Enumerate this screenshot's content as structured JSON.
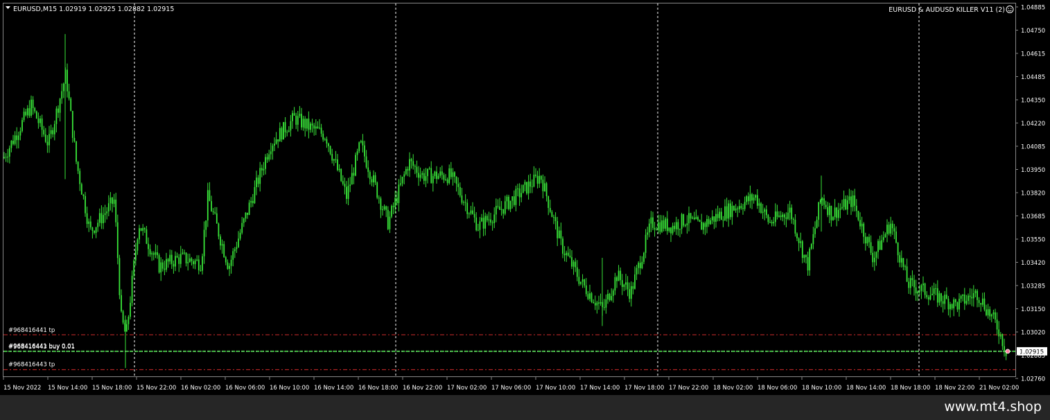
{
  "chart_header": {
    "symbol_info": "EURUSD,M15  1.02919 1.02925 1.02882 1.02915",
    "expert_name": "EURUSD & AUDUSD KILLER V11 (2)",
    "expert_icon": "smiley-face-icon"
  },
  "price_axis": {
    "labels": [
      "1.04885",
      "1.04750",
      "1.04615",
      "1.04485",
      "1.04350",
      "1.04220",
      "1.04085",
      "1.03950",
      "1.03820",
      "1.03685",
      "1.03550",
      "1.03420",
      "1.03285",
      "1.03150",
      "1.03020",
      "1.02885",
      "1.02760"
    ],
    "current_price": "1.02915"
  },
  "time_axis": {
    "labels": [
      "15 Nov 2022",
      "15 Nov 14:00",
      "15 Nov 18:00",
      "15 Nov 22:00",
      "16 Nov 02:00",
      "16 Nov 06:00",
      "16 Nov 10:00",
      "16 Nov 14:00",
      "16 Nov 18:00",
      "16 Nov 22:00",
      "17 Nov 02:00",
      "17 Nov 06:00",
      "17 Nov 10:00",
      "17 Nov 14:00",
      "17 Nov 18:00",
      "17 Nov 22:00",
      "18 Nov 02:00",
      "18 Nov 06:00",
      "18 Nov 10:00",
      "18 Nov 14:00",
      "18 Nov 18:00",
      "18 Nov 22:00",
      "21 Nov 02:00"
    ]
  },
  "order_lines": {
    "tp_top": "#968416441 tp",
    "entry": "#968416441 buy 0.01",
    "entry_overlap": "#968416443 buy 0.01",
    "tp_bottom": "#968416443 tp"
  },
  "footer": {
    "text": "www.mt4.shop"
  },
  "colors": {
    "background": "#000000",
    "candle": "#39e639",
    "grid": "#ffffff",
    "tp_line": "#d22b2b",
    "entry_line": "#40c040",
    "axis_text": "#ffffff",
    "footer_bg": "#262626"
  },
  "chart_data": {
    "type": "line",
    "title": "EURUSD,M15",
    "x": [
      "15 Nov 2022",
      "15 Nov 14:00",
      "15 Nov 18:00",
      "15 Nov 22:00",
      "16 Nov 02:00",
      "16 Nov 06:00",
      "16 Nov 10:00",
      "16 Nov 14:00",
      "16 Nov 18:00",
      "16 Nov 22:00",
      "17 Nov 02:00",
      "17 Nov 06:00",
      "17 Nov 10:00",
      "17 Nov 14:00",
      "17 Nov 18:00",
      "17 Nov 22:00",
      "18 Nov 02:00",
      "18 Nov 06:00",
      "18 Nov 10:00",
      "18 Nov 14:00",
      "18 Nov 18:00",
      "18 Nov 22:00",
      "21 Nov 02:00"
    ],
    "series": [
      {
        "values": [
          1.041,
          1.0415,
          1.0325,
          1.034,
          1.035,
          1.0375,
          1.0425,
          1.039,
          1.037,
          1.0395,
          1.037,
          1.0385,
          1.034,
          1.032,
          1.0365,
          1.0365,
          1.0375,
          1.0365,
          1.0375,
          1.037,
          1.0325,
          1.0315,
          1.0292
        ]
      }
    ],
    "price_markers": {
      "tp_upper": 1.0301,
      "entry": 1.02915,
      "tp_lower": 1.0281,
      "current": 1.02915
    },
    "ylim": [
      1.0276,
      1.04885
    ],
    "grid": "vertical dashed",
    "xlabel": "",
    "ylabel": ""
  }
}
